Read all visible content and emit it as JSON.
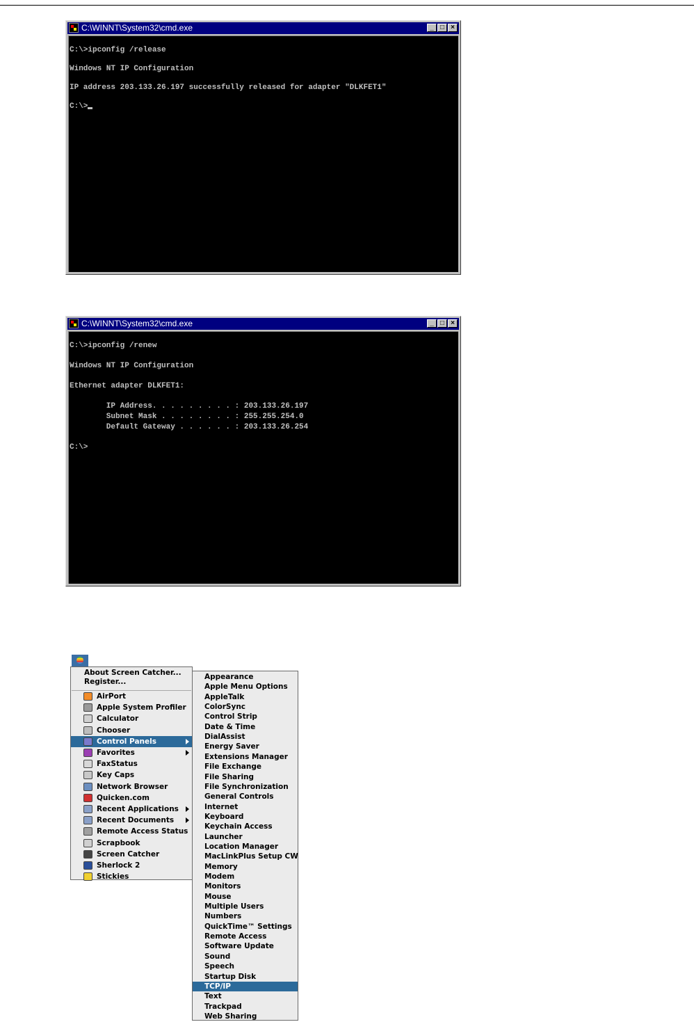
{
  "cmd_release": {
    "title": "C:\\WINNT\\System32\\cmd.exe",
    "lines": [
      "C:\\>ipconfig /release",
      "Windows NT IP Configuration",
      "IP address 203.133.26.197 successfully released for adapter \"DLKFET1\"",
      "C:\\>"
    ]
  },
  "cmd_renew": {
    "title": "C:\\WINNT\\System32\\cmd.exe",
    "lines": [
      "C:\\>ipconfig /renew",
      "Windows NT IP Configuration",
      "Ethernet adapter DLKFET1:",
      "        IP Address. . . . . . . . . : 203.133.26.197",
      "        Subnet Mask . . . . . . . . : 255.255.254.0",
      "        Default Gateway . . . . . . : 203.133.26.254",
      "C:\\>"
    ]
  },
  "window_buttons": {
    "minimize": "_",
    "maximize": "□",
    "close": "×"
  },
  "apple_menu": {
    "top_items": [
      "About Screen Catcher...",
      "Register..."
    ],
    "items": [
      {
        "label": "AirPort",
        "icon": "airport-icon",
        "color": "#f28c28"
      },
      {
        "label": "Apple System Profiler",
        "icon": "profiler-icon",
        "color": "#9a9a9a"
      },
      {
        "label": "Calculator",
        "icon": "calculator-icon",
        "color": "#d0d0d0"
      },
      {
        "label": "Chooser",
        "icon": "chooser-icon",
        "color": "#bdbdbd"
      },
      {
        "label": "Control Panels",
        "icon": "control-panels-icon",
        "color": "#7a7acc",
        "submenu": true,
        "selected": true
      },
      {
        "label": "Favorites",
        "icon": "favorites-icon",
        "color": "#9b3fb3",
        "submenu": true
      },
      {
        "label": "FaxStatus",
        "icon": "fax-icon",
        "color": "#d8d8d8"
      },
      {
        "label": "Key Caps",
        "icon": "keycaps-icon",
        "color": "#c8c8c8"
      },
      {
        "label": "Network Browser",
        "icon": "network-icon",
        "color": "#6c8fc0"
      },
      {
        "label": "Quicken.com",
        "icon": "quicken-icon",
        "color": "#d23030"
      },
      {
        "label": "Recent Applications",
        "icon": "recent-apps-icon",
        "color": "#8aa0c8",
        "submenu": true
      },
      {
        "label": "Recent Documents",
        "icon": "recent-docs-icon",
        "color": "#8aa0c8",
        "submenu": true
      },
      {
        "label": "Remote Access Status",
        "icon": "remote-access-icon",
        "color": "#a0a0a0"
      },
      {
        "label": "Scrapbook",
        "icon": "scrapbook-icon",
        "color": "#d0d0d0"
      },
      {
        "label": "Screen Catcher",
        "icon": "camera-icon",
        "color": "#444444"
      },
      {
        "label": "Sherlock 2",
        "icon": "sherlock-icon",
        "color": "#2a4f9a"
      },
      {
        "label": "Stickies",
        "icon": "stickies-icon",
        "color": "#f0d030"
      }
    ]
  },
  "control_panels_submenu": {
    "items": [
      "Appearance",
      "Apple Menu Options",
      "AppleTalk",
      "ColorSync",
      "Control Strip",
      "Date & Time",
      "DialAssist",
      "Energy Saver",
      "Extensions Manager",
      "File Exchange",
      "File Sharing",
      "File Synchronization",
      "General Controls",
      "Internet",
      "Keyboard",
      "Keychain Access",
      "Launcher",
      "Location Manager",
      "MacLinkPlus Setup CW",
      "Memory",
      "Modem",
      "Monitors",
      "Mouse",
      "Multiple Users",
      "Numbers",
      "QuickTime™ Settings",
      "Remote Access",
      "Software Update",
      "Sound",
      "Speech",
      "Startup Disk",
      "TCP/IP",
      "Text",
      "Trackpad",
      "Web Sharing"
    ],
    "selected": "TCP/IP"
  }
}
